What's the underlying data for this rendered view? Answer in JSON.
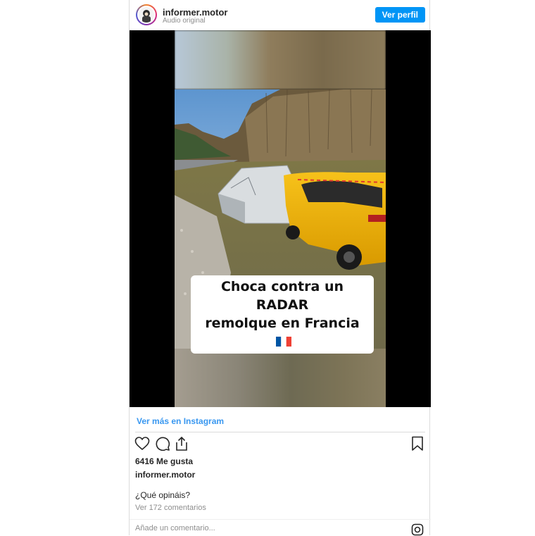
{
  "post": {
    "username": "informer.motor",
    "audio": "Audio original",
    "profile_button": "Ver perfil"
  },
  "video": {
    "caption_line1": "Choca contra un RADAR",
    "caption_line2": "remolque en Francia"
  },
  "footer": {
    "more_link": "Ver más en Instagram",
    "likes": "6416 Me gusta",
    "owner": "informer.motor",
    "comment": "¿Qué opináis?",
    "view_comments": "Ver 172 comentarios",
    "add_comment": "Añade un comentario..."
  },
  "icons": [
    "heart-icon",
    "comment-icon",
    "share-icon",
    "bookmark-icon",
    "instagram-icon"
  ],
  "colors": {
    "accent": "#0095f6",
    "link": "#3897f0",
    "car": "#f2b705"
  }
}
